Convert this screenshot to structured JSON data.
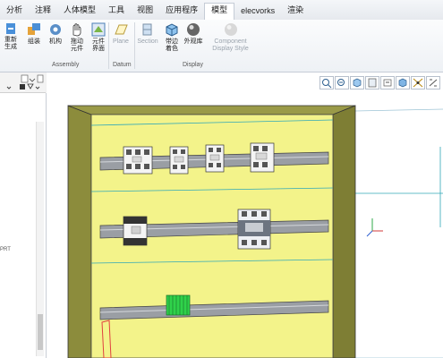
{
  "tabs": [
    "分析",
    "注释",
    "人体模型",
    "工具",
    "视图",
    "应用程序",
    "模型",
    "elecvorks",
    "渲染"
  ],
  "ribbon": {
    "buttons": {
      "regen": "重新\n生成",
      "assembly": "组装",
      "mechanism": "机构",
      "drag": "拖动\n元件",
      "component_ui": "元件\n界面",
      "plane": "Plane",
      "section": "Section",
      "color_appearance": "带边\n着色",
      "appearance_lib": "外观库",
      "component_display": "Component\nDisplay Style"
    },
    "groups": {
      "assembly": "Assembly",
      "datum": "Datum",
      "display": "Display"
    }
  },
  "left_panel": {
    "fragment_text": "PRT"
  },
  "colors": {
    "panel_yellow": "#f3f38a",
    "cabinet_frame": "#8c8c3c",
    "rail_gray": "#9a9ea4",
    "terminal_green": "#2fd24a",
    "edge_cyan": "#30a8b8",
    "view_bg": "#ffffff"
  }
}
